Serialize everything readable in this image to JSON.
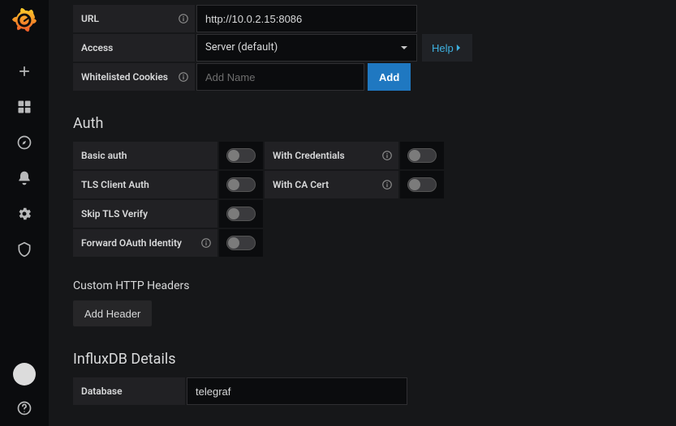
{
  "http": {
    "url_label": "URL",
    "url_value": "http://10.0.2.15:8086",
    "access_label": "Access",
    "access_value": "Server (default)",
    "help_label": "Help",
    "cookies_label": "Whitelisted Cookies",
    "cookies_placeholder": "Add Name",
    "add_label": "Add"
  },
  "auth": {
    "title": "Auth",
    "basic_auth": "Basic auth",
    "with_credentials": "With Credentials",
    "tls_client_auth": "TLS Client Auth",
    "with_ca_cert": "With CA Cert",
    "skip_tls_verify": "Skip TLS Verify",
    "forward_oauth": "Forward OAuth Identity"
  },
  "custom_headers": {
    "title": "Custom HTTP Headers",
    "add_header_label": "Add Header"
  },
  "influxdb": {
    "title": "InfluxDB Details",
    "database_label": "Database",
    "database_value": "telegraf"
  }
}
